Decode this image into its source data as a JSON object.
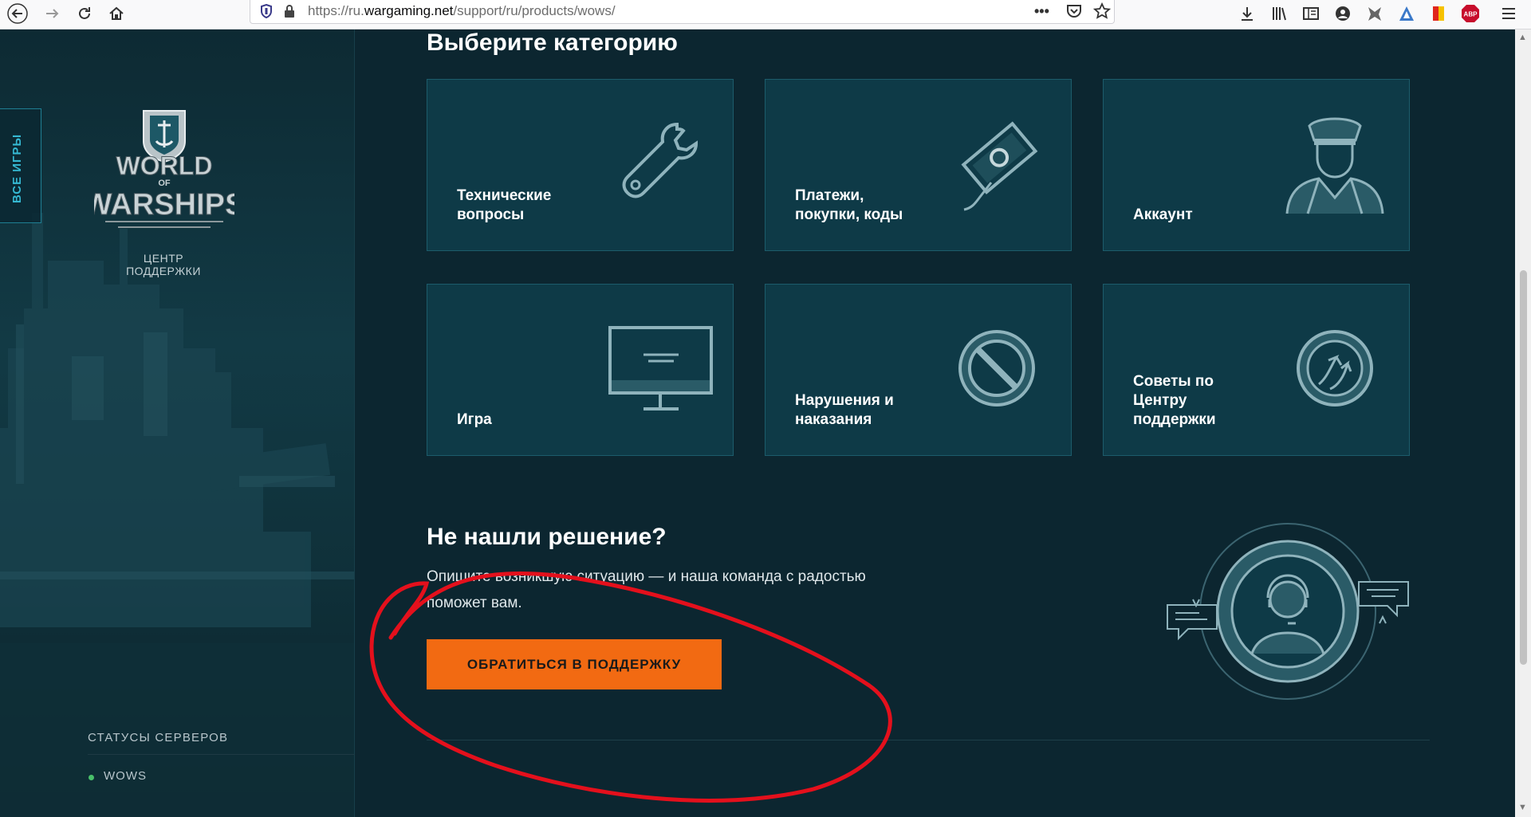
{
  "browser": {
    "url_prefix": "https://ru.",
    "url_domain": "wargaming.net",
    "url_path": "/support/ru/products/wows/",
    "icons": [
      "back-icon",
      "forward-icon",
      "reload-icon",
      "home-icon",
      "tracking-shield-icon",
      "lock-icon",
      "page-actions-icon",
      "pocket-icon",
      "bookmark-star-icon",
      "downloads-icon",
      "library-icon",
      "reader-icon",
      "account-icon",
      "extension-icon",
      "extension-icon",
      "extension-icon",
      "abp-icon",
      "menu-icon"
    ],
    "abp_label": "ABP"
  },
  "sidebar": {
    "all_games": "ВСЕ ИГРЫ",
    "logo_line1": "WORLD",
    "logo_line2": "OF",
    "logo_line3": "WARSHIPS",
    "support_center": "ЦЕНТР ПОДДЕРЖКИ",
    "servers_title": "СТАТУСЫ СЕРВЕРОВ",
    "server_name": "WOWS",
    "server_status_color": "#49c06a"
  },
  "main": {
    "category_title": "Выберите категорию",
    "categories": [
      {
        "label": "Технические вопросы",
        "icon": "wrench-icon"
      },
      {
        "label": "Платежи, покупки, коды",
        "icon": "payment-icon"
      },
      {
        "label": "Аккаунт",
        "icon": "officer-icon"
      },
      {
        "label": "Игра",
        "icon": "monitor-icon"
      },
      {
        "label": "Нарушения и наказания",
        "icon": "prohibited-icon"
      },
      {
        "label": "Советы по Центру поддержки",
        "icon": "tips-icon"
      }
    ],
    "not_found_title": "Не нашли решение?",
    "not_found_desc": "Опишите возникшую ситуацию — и наша команда с радостью поможет вам.",
    "contact_button": "ОБРАТИТЬСЯ В ПОДДЕРЖКУ",
    "accent_color": "#f26a12"
  }
}
